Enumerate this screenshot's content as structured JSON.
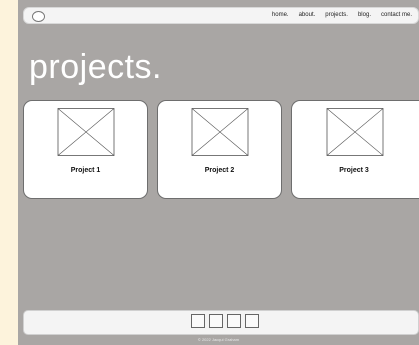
{
  "nav": {
    "links": [
      "home.",
      "about.",
      "projects.",
      "blog.",
      "contact me."
    ]
  },
  "page": {
    "title": "projects."
  },
  "projects": [
    {
      "title": "Project 1"
    },
    {
      "title": "Project 2"
    },
    {
      "title": "Project 3"
    }
  ],
  "footer": {
    "social_icons": [
      "placeholder-icon",
      "placeholder-icon",
      "placeholder-icon",
      "placeholder-icon"
    ],
    "copyright": "© 2022 Jacqui Graham"
  },
  "colors": {
    "background": "#a9a6a4",
    "card": "#ffffff",
    "bar": "#f4f4f4",
    "side_strip": "#fdf3dc"
  }
}
